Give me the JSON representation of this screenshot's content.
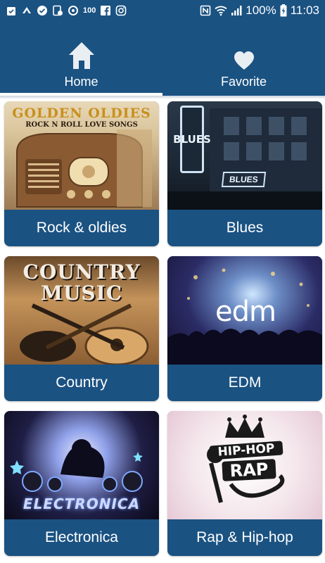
{
  "status_bar": {
    "left_icons": [
      "clipboard-check-icon",
      "carrier-logo-icon",
      "check-circle-icon",
      "device-check-icon",
      "data-saver-icon",
      "badge-100-icon",
      "facebook-icon",
      "instagram-icon"
    ],
    "badge_text": "100",
    "right_icons": [
      "nfc-icon",
      "wifi-icon",
      "signal-icon"
    ],
    "battery": "100%",
    "time": "11:03"
  },
  "tabs": [
    {
      "label": "Home",
      "icon": "home-icon",
      "active": true
    },
    {
      "label": "Favorite",
      "icon": "heart-icon",
      "active": false
    }
  ],
  "genres": [
    {
      "label": "Rock & oldies",
      "art_title": "GOLDEN OLDIES",
      "art_subtitle": "ROCK N ROLL LOVE SONGS"
    },
    {
      "label": "Blues",
      "art_title": "BLUES",
      "art_subtitle": "BLUES"
    },
    {
      "label": "Country",
      "art_title": "COUNTRY MUSIC"
    },
    {
      "label": "EDM",
      "art_title": "edm"
    },
    {
      "label": "Electronica",
      "art_title": "ELECTRONICA"
    },
    {
      "label": "Rap & Hip-hop",
      "art_title": "HIP-HOP",
      "art_subtitle": "RAP"
    }
  ],
  "colors": {
    "primary": "#1a5282",
    "text_on_primary": "#ffffff",
    "background": "#ffffff"
  }
}
